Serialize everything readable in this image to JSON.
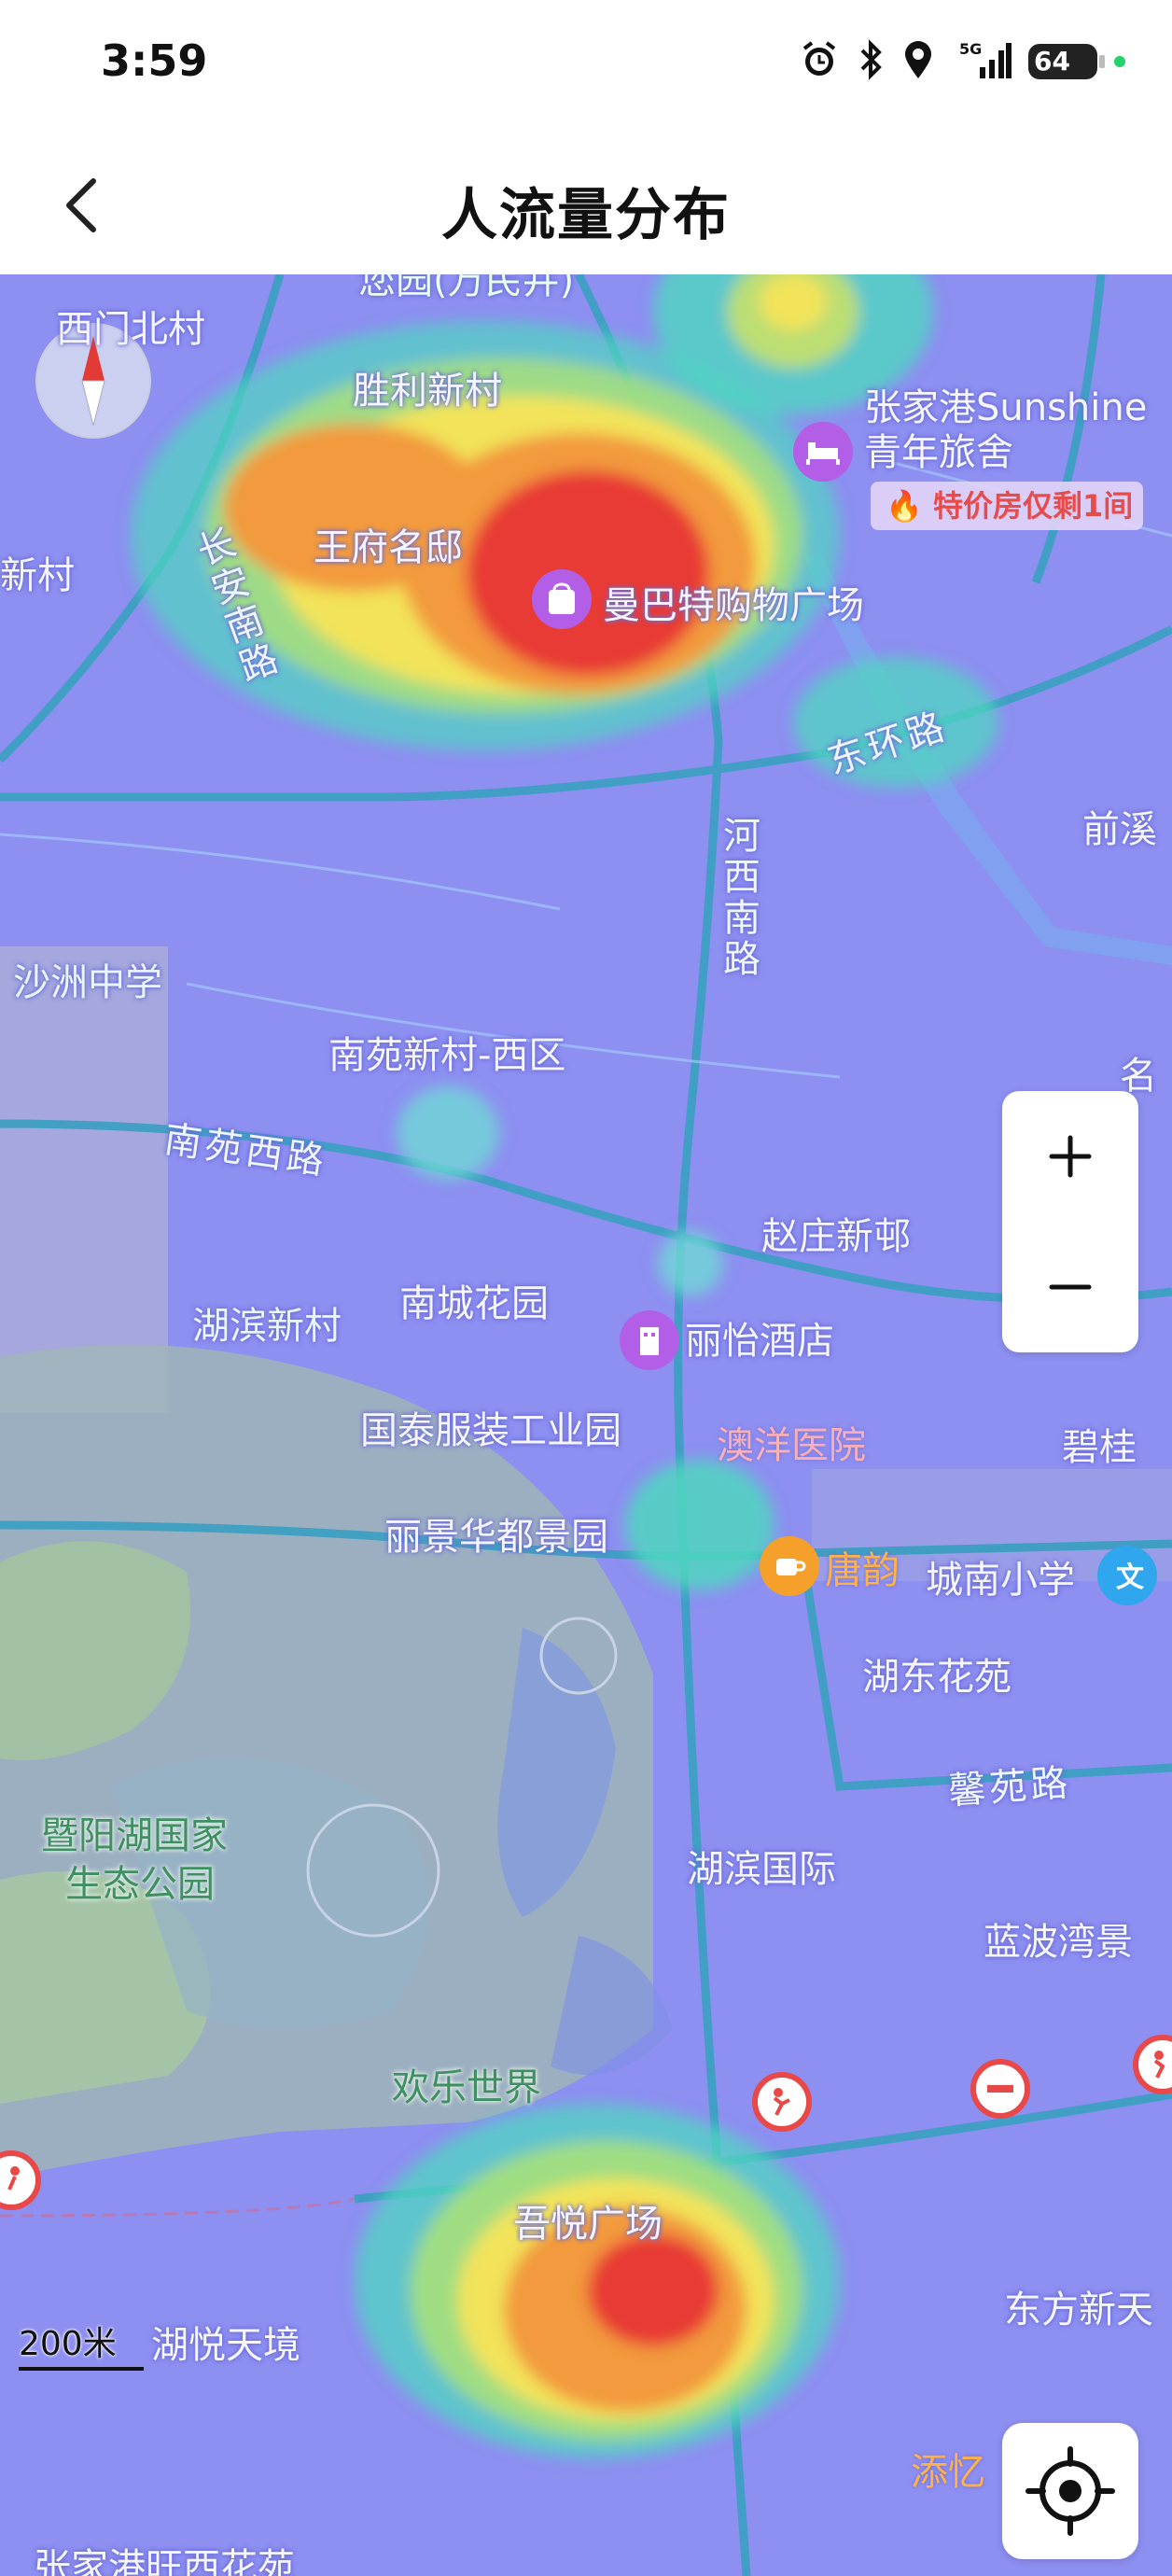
{
  "status_bar": {
    "time": "3:59",
    "battery": "64",
    "signal": "5G"
  },
  "header": {
    "title": "人流量分布"
  },
  "map": {
    "labels": {
      "ximen": "西门北村",
      "shengli": "胜利新村",
      "suyuan": "您园(万民井)",
      "zhangjiagang_hostel": "张家港Sunshine",
      "hostel_line2": "青年旅舍",
      "promo": "特价房仅剩1间",
      "xincun_left": "新村",
      "wangfu": "王府名邸",
      "changan_road": "长安南路",
      "manbat": "曼巴特购物广场",
      "donghuan_road": "东环路",
      "hexi_road": "河西南路",
      "qianxi": "前溪",
      "shazhou": "沙洲中学",
      "nanyuan_west": "南苑新村-西区",
      "ming": "名",
      "nanyuan_road": "南苑西路",
      "zhaozhuang": "赵庄新邨",
      "hubin_xincun": "湖滨新村",
      "nancheng": "南城花园",
      "liyi": "丽怡酒店",
      "guotai": "国泰服装工业园",
      "aoyang": "澳洋医院",
      "bigui": "碧桂",
      "lijing": "丽景华都景园",
      "tangyun": "唐韵",
      "chengnan": "城南小学",
      "hudong": "湖东花苑",
      "xinyuan_road": "馨苑路",
      "park_line1": "暨阳湖国家",
      "park_line2": "生态公园",
      "hubin_guoji": "湖滨国际",
      "lanbo": "蓝波湾景",
      "happy": "欢乐世界",
      "wuyue": "吾悦广场",
      "hyue": "湖悦天境",
      "dongfang": "东方新天",
      "tianyi": "添忆",
      "bottom_left": "张家港旺西花苑"
    },
    "scale": "200米"
  },
  "heat_legend_colors": {
    "low": "#8d8ff1",
    "mid": "#4fd6c0",
    "high": "#f2e35a",
    "very_high": "#f29a3c",
    "max": "#e83a35"
  },
  "icons": {
    "back": "chevron-left-icon",
    "zoom_in": "plus-icon",
    "zoom_out": "minus-icon",
    "locate": "locate-icon",
    "compass": "compass-icon"
  }
}
